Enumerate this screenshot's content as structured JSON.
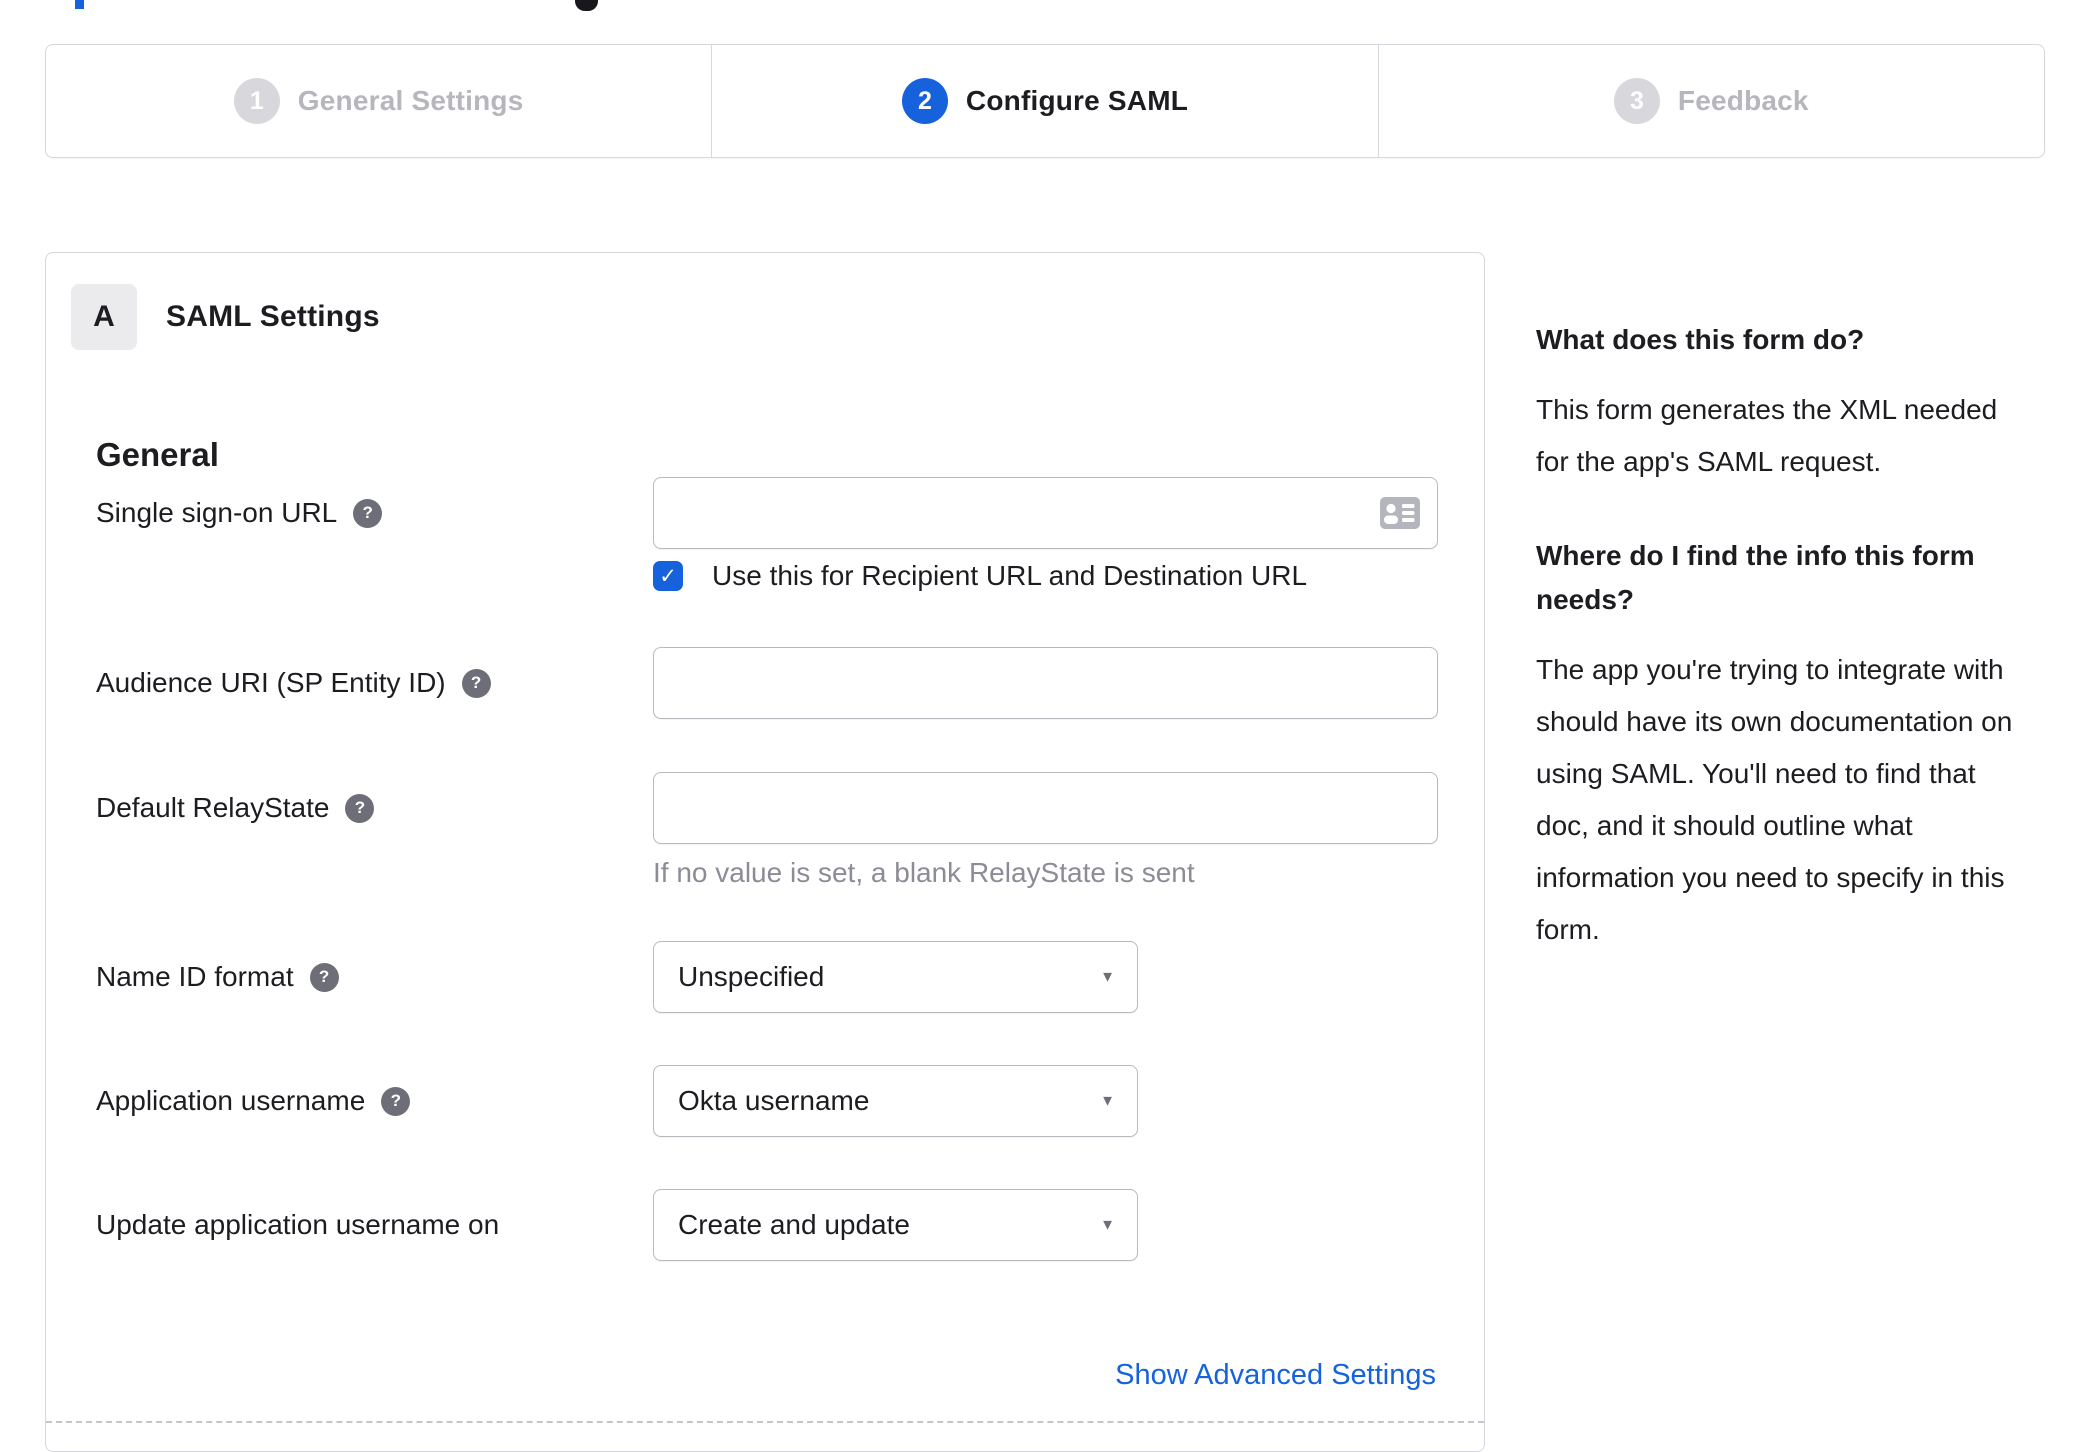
{
  "stepper": {
    "steps": [
      {
        "number": "1",
        "label": "General Settings",
        "state": "inactive"
      },
      {
        "number": "2",
        "label": "Configure SAML",
        "state": "active"
      },
      {
        "number": "3",
        "label": "Feedback",
        "state": "inactive"
      }
    ]
  },
  "panel": {
    "badge": "A",
    "title": "SAML Settings",
    "section_heading": "General",
    "fields": {
      "sso": {
        "label": "Single sign-on URL",
        "value": "",
        "checkbox": {
          "checked": true,
          "label": "Use this for Recipient URL and Destination URL"
        }
      },
      "audience": {
        "label": "Audience URI (SP Entity ID)",
        "value": ""
      },
      "relay": {
        "label": "Default RelayState",
        "value": "",
        "hint": "If no value is set, a blank RelayState is sent"
      },
      "name_id": {
        "label": "Name ID format",
        "value": "Unspecified"
      },
      "app_username": {
        "label": "Application username",
        "value": "Okta username"
      },
      "update_username": {
        "label": "Update application username on",
        "value": "Create and update"
      }
    },
    "advanced_link": "Show Advanced Settings"
  },
  "sidebar": {
    "q1": "What does this form do?",
    "a1": "This form generates the XML needed for the app's SAML request.",
    "q2": "Where do I find the info this form needs?",
    "a2": "The app you're trying to integrate with should have its own documentation on using SAML. You'll need to find that doc, and it should outline what information you need to specify in this form."
  },
  "icons": {
    "help": "?",
    "caret": "▼",
    "check": "✓"
  },
  "colors": {
    "accent_blue": "#1662dd",
    "step_inactive_circle": "#d7d7dc",
    "step_inactive_text": "#b6b6bc",
    "text_dark": "#1d1d21",
    "text_muted": "#8c8c96",
    "panel_border": "#d7d7dd",
    "input_border": "#b9b9c0"
  }
}
